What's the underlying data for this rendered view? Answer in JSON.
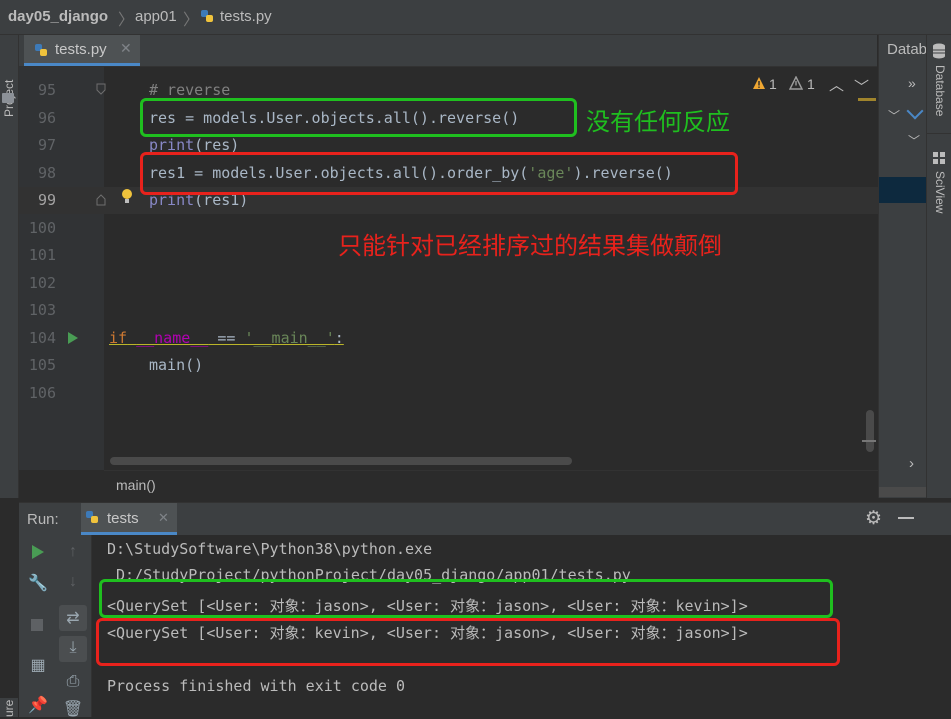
{
  "breadcrumb": {
    "project": "day05_django",
    "folder": "app01",
    "file": "tests.py"
  },
  "left_strip": {
    "project_label": "Project",
    "bottom_label": "ure"
  },
  "editor_tab": {
    "label": "tests.py"
  },
  "inspection": {
    "warnings_a": "1",
    "warnings_b": "1"
  },
  "right_panel": {
    "database_short": "Datab",
    "database_label": "Database",
    "sciview_label": "SciView"
  },
  "gutter": {
    "line_numbers": [
      "95",
      "96",
      "97",
      "98",
      "99",
      "100",
      "101",
      "102",
      "103",
      "104",
      "105",
      "106"
    ]
  },
  "code": {
    "l95": "# reverse",
    "l96": "res = models.User.objects.all().reverse()",
    "l97_fn": "print",
    "l97_rest": "(res)",
    "l98_a": "res1 = models.User.objects.all().order_by(",
    "l98_str": "'age'",
    "l98_b": ").reverse()",
    "l99_fn": "print",
    "l99_rest": "(res1)",
    "l104_kw": "if",
    "l104_name": "__name__",
    "l104_op": " == ",
    "l104_str": "'__main__'",
    "l104_colon": ":",
    "l105": "main()"
  },
  "annotations": {
    "green_note": "没有任何反应",
    "red_note": "只能针对已经排序过的结果集做颠倒"
  },
  "editor_footer": {
    "crumb": "main()"
  },
  "run_panel": {
    "label": "Run:",
    "tab": "tests",
    "output": [
      "D:\\StudySoftware\\Python38\\python.exe",
      " D:/StudyProject/pythonProject/day05_django/app01/tests.py",
      "<QuerySet [<User: 对象：jason>, <User: 对象：jason>, <User: 对象：kevin>]>",
      "<QuerySet [<User: 对象：kevin>, <User: 对象：jason>, <User: 对象：jason>]>",
      "",
      "Process finished with exit code 0"
    ]
  },
  "colors": {
    "background": "#2b2b2b",
    "keyword": "#cc7832",
    "string": "#6a8759",
    "comment": "#808080",
    "builtin": "#8888c6",
    "annotation_green": "#1fbf1f",
    "annotation_red": "#e8221c"
  },
  "icons": [
    "python-file-icon",
    "chevron-right-icon",
    "close-icon",
    "warning-icon",
    "arrow-up-icon",
    "arrow-down-icon",
    "lightbulb-icon",
    "run-gutter-icon",
    "fold-icon",
    "gear-icon",
    "minimize-icon",
    "play-icon",
    "wrench-icon",
    "stop-icon",
    "soft-wrap-icon",
    "scroll-to-end-icon",
    "print-icon",
    "trash-icon",
    "layout-icon",
    "pin-icon",
    "database-icon",
    "sciview-icon"
  ]
}
